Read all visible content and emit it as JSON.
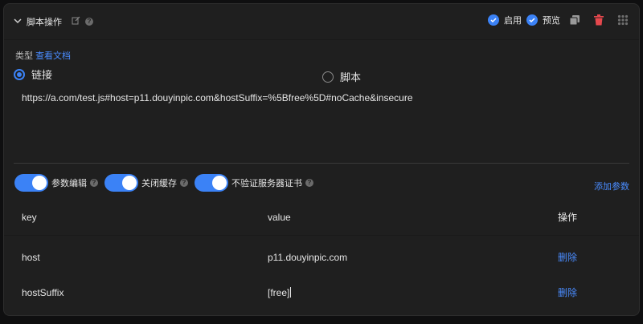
{
  "header": {
    "title": "脚本操作",
    "enable_label": "启用",
    "preview_label": "预览"
  },
  "type_section": {
    "label": "类型",
    "docs_link": "查看文档",
    "options": [
      {
        "label": "链接",
        "selected": true
      },
      {
        "label": "脚本",
        "selected": false
      }
    ]
  },
  "url_value": "https://a.com/test.js#host=p11.douyinpic.com&hostSuffix=%5Bfree%5D#noCache&insecure",
  "toggles": [
    {
      "label": "参数编辑",
      "on": true
    },
    {
      "label": "关闭缓存",
      "on": true
    },
    {
      "label": "不验证服务器证书",
      "on": true
    }
  ],
  "add_param_label": "添加参数",
  "table": {
    "headers": [
      "key",
      "value",
      "操作"
    ],
    "rows": [
      {
        "key": "host",
        "value": "p11.douyinpic.com",
        "action": "删除"
      },
      {
        "key": "hostSuffix",
        "value": "[free]",
        "action": "删除"
      }
    ]
  },
  "colors": {
    "accent": "#3b82f6",
    "link": "#4a8cff",
    "delete": "#e5484d",
    "panel_bg": "#1f1f1f"
  }
}
